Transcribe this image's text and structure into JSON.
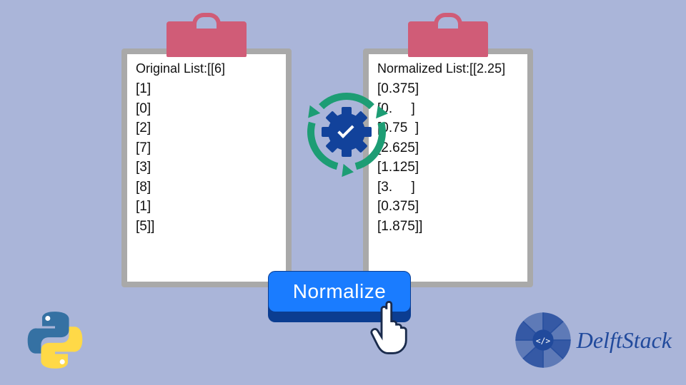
{
  "left": {
    "title": "Original List:[[6]",
    "items": [
      "[1]",
      "[0]",
      "[2]",
      "[7]",
      "[3]",
      "[8]",
      "[1]",
      "[5]]"
    ]
  },
  "right": {
    "title": "Normalized List:[[2.25]",
    "items": [
      "[0.375]",
      "[0.     ]",
      "[0.75  ]",
      "[2.625]",
      "[1.125]",
      "[3.     ]",
      "[0.375]",
      "[1.875]]"
    ]
  },
  "button": {
    "label": "Normalize"
  },
  "brand": {
    "name": "DelftStack"
  },
  "icons": {
    "python": "python-logo",
    "gear": "gear-check-icon",
    "sync": "sync-arrows-icon",
    "pointer": "click-pointer-icon",
    "mandala": "delftstack-mandala-icon"
  },
  "colors": {
    "bg": "#aab5d9",
    "clip": "#d05c77",
    "board": "#a9a9a9",
    "gear": "#12429b",
    "arc": "#1d9d74",
    "btn": "#1a7cff",
    "brand": "#214a9c"
  }
}
